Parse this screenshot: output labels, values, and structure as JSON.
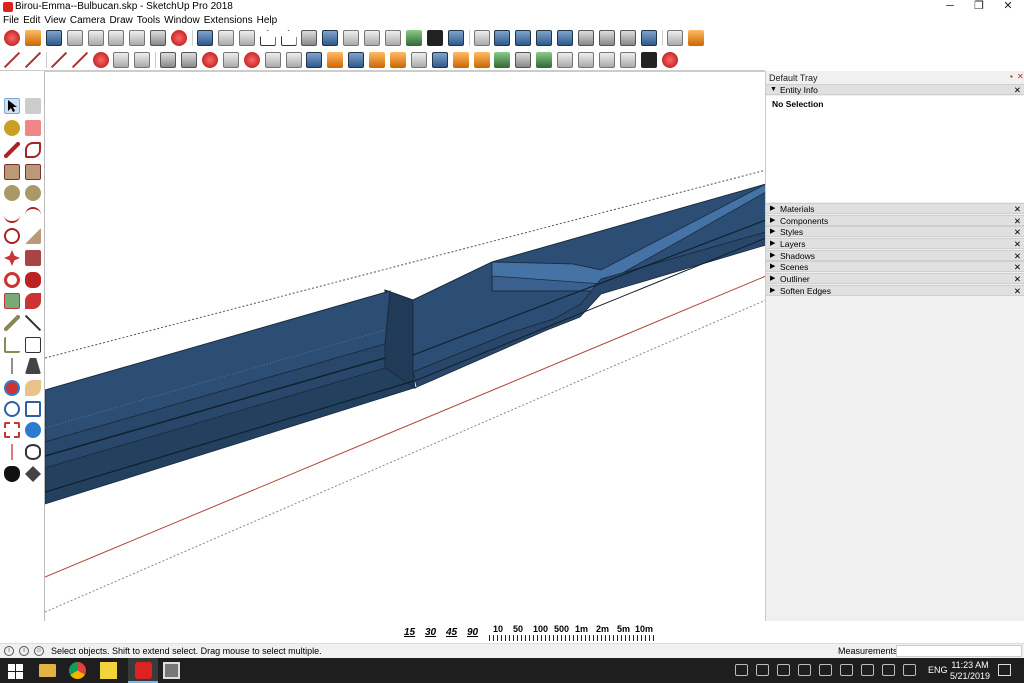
{
  "window": {
    "title": "Birou-Emma--Bulbucan.skp - SketchUp Pro 2018",
    "controls": [
      "─",
      "❐",
      "✕"
    ]
  },
  "menu": [
    "File",
    "Edit",
    "View",
    "Camera",
    "Draw",
    "Tools",
    "Window",
    "Extensions",
    "Help"
  ],
  "tray": {
    "title": "Default Tray",
    "controls": [
      "▪",
      "✕"
    ],
    "panels": [
      {
        "label": "Entity Info",
        "expanded": true
      },
      {
        "label": "Materials",
        "expanded": false
      },
      {
        "label": "Components",
        "expanded": false
      },
      {
        "label": "Styles",
        "expanded": false
      },
      {
        "label": "Layers",
        "expanded": false
      },
      {
        "label": "Shadows",
        "expanded": false
      },
      {
        "label": "Scenes",
        "expanded": false
      },
      {
        "label": "Outliner",
        "expanded": false
      },
      {
        "label": "Soften Edges",
        "expanded": false
      }
    ],
    "entity_info": {
      "selection": "No Selection"
    },
    "expand_glyph": "▼",
    "collapse_glyph": "▶",
    "close_glyph": "✕"
  },
  "measure_toolbar": {
    "angles": [
      "15",
      "30",
      "45",
      "90"
    ],
    "scales": [
      "10",
      "50",
      "100",
      "500",
      "1m",
      "2m",
      "5m",
      "10m"
    ]
  },
  "status": {
    "hint": "Select objects. Shift to extend select. Drag mouse to select multiple.",
    "measurements_label": "Measurements",
    "icons": [
      "i",
      "i",
      "☺"
    ]
  },
  "taskbar": {
    "language": "ENG",
    "time": "11:23 AM",
    "date": "5/21/2019"
  },
  "colors": {
    "model_fill": "#2d4e74",
    "model_dark": "#1d3550",
    "red_axis": "#b0453a",
    "taskbar": "#1e1e1e"
  }
}
